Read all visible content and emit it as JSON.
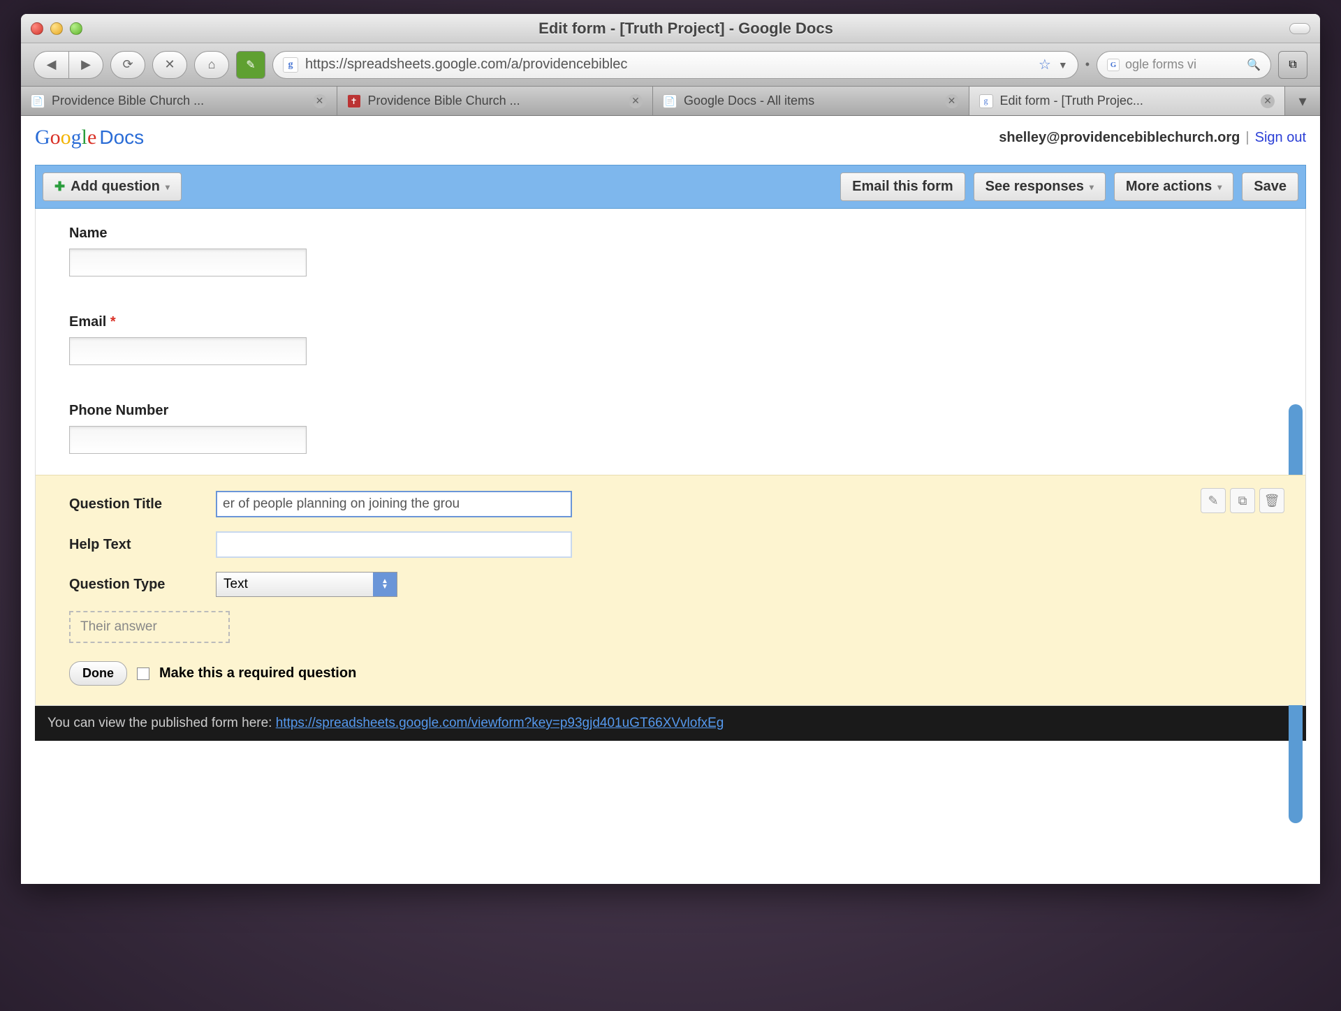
{
  "window": {
    "title": "Edit form - [Truth Project] - Google Docs"
  },
  "browser": {
    "url": "https://spreadsheets.google.com/a/providencebiblec",
    "search_placeholder": "ogle forms vi",
    "tabs": [
      {
        "label": "Providence Bible Church ..."
      },
      {
        "label": "Providence Bible Church ..."
      },
      {
        "label": "Google Docs - All items"
      },
      {
        "label": "Edit form - [Truth Projec..."
      }
    ]
  },
  "header": {
    "docs_label": "Docs",
    "user_email": "shelley@providencebiblechurch.org",
    "sign_out": "Sign out"
  },
  "actionbar": {
    "add_question": "Add question",
    "email_form": "Email this form",
    "see_responses": "See responses",
    "more_actions": "More actions",
    "save": "Save"
  },
  "fields": [
    {
      "label": "Name",
      "required": false
    },
    {
      "label": "Email",
      "required": true
    },
    {
      "label": "Phone Number",
      "required": false
    }
  ],
  "editor": {
    "question_title_label": "Question Title",
    "question_title_value": "er of people planning on joining the grou",
    "help_text_label": "Help Text",
    "help_text_value": "",
    "question_type_label": "Question Type",
    "question_type_value": "Text",
    "answer_placeholder": "Their answer",
    "done_label": "Done",
    "required_label": "Make this a required question"
  },
  "footer": {
    "prefix": "You can view the published form here: ",
    "link": "https://spreadsheets.google.com/viewform?key=p93gjd401uGT66XVvlofxEg"
  }
}
